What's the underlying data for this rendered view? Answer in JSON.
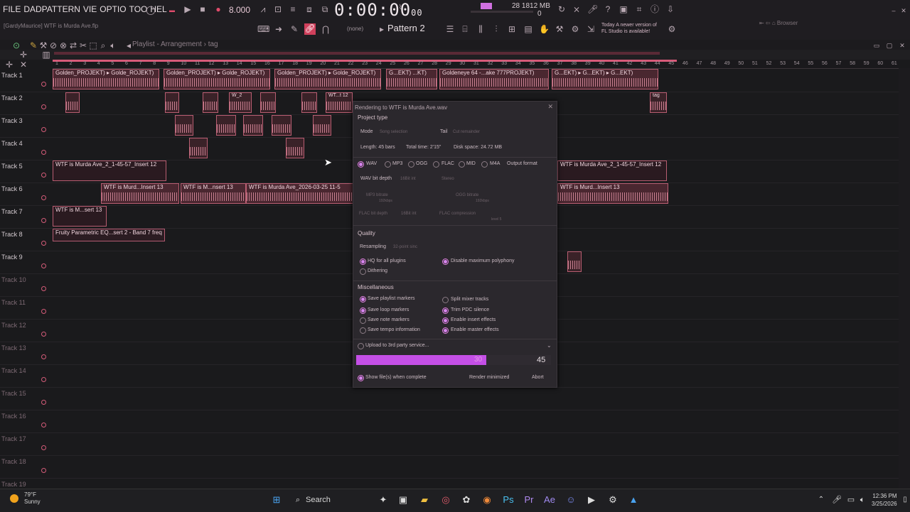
{
  "menu": [
    "FILE",
    "EDIT",
    "ADD",
    "PATTERN",
    "VIEW",
    "OPTIONS",
    "TOOLS",
    "HELP"
  ],
  "menu_display": [
    "FILE",
    "DADPATTERN",
    "VIE",
    "OPTIO",
    "TOO",
    "HEL"
  ],
  "hint": "[GardyMaurice] WTF is Murda Ave.flp",
  "transport": {
    "bpm": "8.000",
    "time": "0:00:00",
    "beat": "00"
  },
  "cpu": {
    "cpu_line": "28   1812 MB",
    "poly_line": "0"
  },
  "pattern": "Pattern 2",
  "snap": "(none)",
  "news": {
    "line1": "Today  A newer version of",
    "line2": "FL Studio is available!"
  },
  "browser": "Browser",
  "playlist": {
    "title": "Playlist - Arrangement › tag"
  },
  "ruler_ticks": [
    "1",
    "2",
    "3",
    "4",
    "5",
    "6",
    "7",
    "8",
    "9",
    "10",
    "11",
    "12",
    "13",
    "14",
    "15",
    "16",
    "17",
    "18",
    "19",
    "20",
    "21",
    "22",
    "23",
    "24",
    "25",
    "26",
    "27",
    "28",
    "29",
    "30",
    "31",
    "32",
    "33",
    "34",
    "35",
    "36",
    "37",
    "38",
    "39",
    "40",
    "41",
    "42",
    "43",
    "44",
    "45",
    "46",
    "47",
    "48",
    "49",
    "50",
    "51",
    "52",
    "53",
    "54",
    "55",
    "56",
    "57",
    "58",
    "59",
    "60",
    "61"
  ],
  "tracks": [
    "Track 1",
    "Track 2",
    "Track 3",
    "Track 4",
    "Track 5",
    "Track 6",
    "Track 7",
    "Track 8",
    "Track 9",
    "Track 10",
    "Track 11",
    "Track 12",
    "Track 13",
    "Track 14",
    "Track 15",
    "Track 16",
    "Track 17",
    "Track 18",
    "Track 19"
  ],
  "clips": {
    "t1a": "Golden_PROJEKT) ▸ Golde_ROJEKT)",
    "t1b": "Golden_PROJEKT) ▸ Golde_ROJEKT)",
    "t1c": "Golden_PROJEKT) ▸ Golde_ROJEKT)",
    "t1d": "G...EKT)  ...KT)",
    "t1e": "Goldeneye 64 -...ake 777PROJEKT)",
    "t1f": "G...EKT) ▸ G...EKT) ▸ G...EKT)",
    "t2a": "W_2",
    "t2b": "WT...t 12",
    "t5a": "WTF is Murda Ave_2_1-45-57_Insert 12",
    "t5b": "WTF is Murda Ave_2_1-45-57_Insert 12",
    "t6a": "WTF is Murd...Insert 13",
    "t6b": "WTF is M...nsert 13",
    "t6c": "WTF is Murda Ave_2026-03-25 11-5",
    "t6d": "WTF is Murd...Insert 13",
    "t7a": "WTF is M...sert 13",
    "t8a": "Fruity Parametric EQ...sert 2 - Band 7 freq",
    "tag": "tag"
  },
  "dialog": {
    "title": "Rendering to WTF is Murda Ave.wav",
    "project_type": "Project type",
    "mode_label": "Mode",
    "mode_value": "Song selection",
    "tail_label": "Tail",
    "tail_value": "Cut remainder",
    "length": "Length: 45 bars",
    "total_time": "Total time: 2'15\"",
    "disk_space": "Disk space: 24.72 MB",
    "formats": [
      "WAV",
      "MP3",
      "OGG",
      "FLAC",
      "MID",
      "M4A"
    ],
    "output_format": "Output format",
    "wav_bit_depth": "WAV bit depth",
    "wav_bit_value": "16Bit int",
    "stereo": "Stereo",
    "mp3_bitrate": "MP3 bitrate",
    "mp3_sub": "192kbps",
    "ogg_bitrate": "OGG bitrate",
    "ogg_sub": "192kbps",
    "flac_bit_depth": "FLAC bit depth",
    "flac_bit_value": "16Bit int",
    "flac_compression": "FLAC compression",
    "flac_comp_sub": "level 5",
    "quality": "Quality",
    "resampling": "Resampling",
    "resampling_value": "32-point sinc",
    "hq_plugins": "HQ for all plugins",
    "disable_poly": "Disable maximum polyphony",
    "dithering": "Dithering",
    "misc": "Miscellaneous",
    "save_playlist": "Save playlist markers",
    "split_mixer": "Split mixer tracks",
    "save_loop": "Save loop markers",
    "trim_pdc": "Trim PDC silence",
    "save_note": "Save note markers",
    "enable_insert": "Enable insert effects",
    "save_tempo": "Save tempo information",
    "enable_master": "Enable master effects",
    "upload": "Upload to 3rd party service...",
    "progress_value": "30",
    "progress_max": "45",
    "progress": 0.667,
    "show_files": "Show file(s) when complete",
    "render_min": "Render minimized",
    "abort": "Abort"
  },
  "taskbar": {
    "temp": "79°F",
    "cond": "Sunny",
    "search": "Search",
    "time": "12:36 PM",
    "date": "3/25/2026"
  },
  "colors": {
    "accent": "#d75a79",
    "progress": "#c44fe6",
    "clip": "#4a2730"
  }
}
